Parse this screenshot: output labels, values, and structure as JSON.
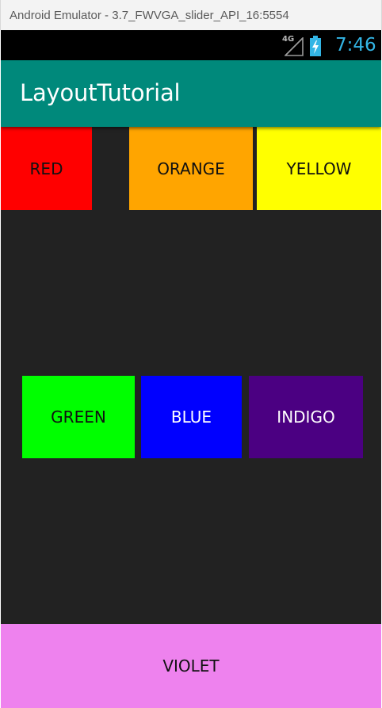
{
  "window": {
    "title": "Android Emulator - 3.7_FWVGA_slider_API_16:5554"
  },
  "status_bar": {
    "network": "4G",
    "time": "7:46",
    "clock_color": "#33b5e5",
    "icons": [
      "signal-icon",
      "battery-charging-icon"
    ]
  },
  "action_bar": {
    "title": "LayoutTutorial",
    "color": "#00897b"
  },
  "boxes": {
    "red": {
      "label": "RED",
      "color": "#ff0000"
    },
    "orange": {
      "label": "ORANGE",
      "color": "#ffa500"
    },
    "yellow": {
      "label": "YELLOW",
      "color": "#ffff00"
    },
    "green": {
      "label": "GREEN",
      "color": "#00ff00"
    },
    "blue": {
      "label": "BLUE",
      "color": "#0000ff"
    },
    "indigo": {
      "label": "INDIGO",
      "color": "#4b0082"
    },
    "violet": {
      "label": "VIOLET",
      "color": "#ee82ee"
    }
  },
  "background_color": "#222222"
}
